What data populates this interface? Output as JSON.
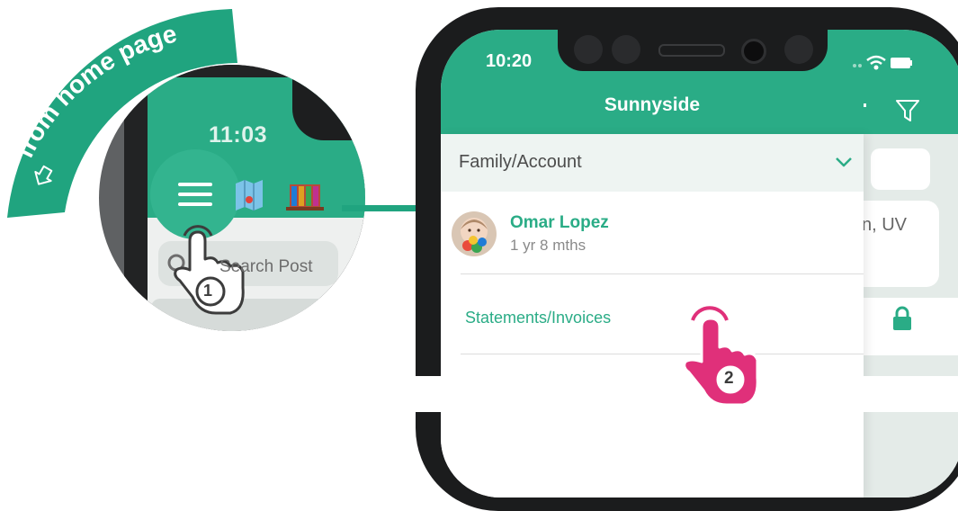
{
  "banner": {
    "text": "from home page",
    "color": "#20a47f"
  },
  "zoom_inset": {
    "time": "11:03",
    "search_placeholder": "Search Post",
    "step_number": "1",
    "icons": [
      "hamburger-menu-icon",
      "map-icon",
      "books-icon",
      "search-icon",
      "tap-hand-icon"
    ]
  },
  "phone": {
    "status_time": "10:20",
    "header_title": "Sunnyside",
    "header_color": "#2aac86",
    "filter_icon": "filter-icon",
    "drawer": {
      "section_label": "Family/Account",
      "child": {
        "name": "Omar Lopez",
        "age": "1 yr 8 mths"
      },
      "menu_item": "Statements/Invoices"
    },
    "background_text": "n, UV",
    "step_number": "2",
    "tap_color": "#e0307a"
  }
}
